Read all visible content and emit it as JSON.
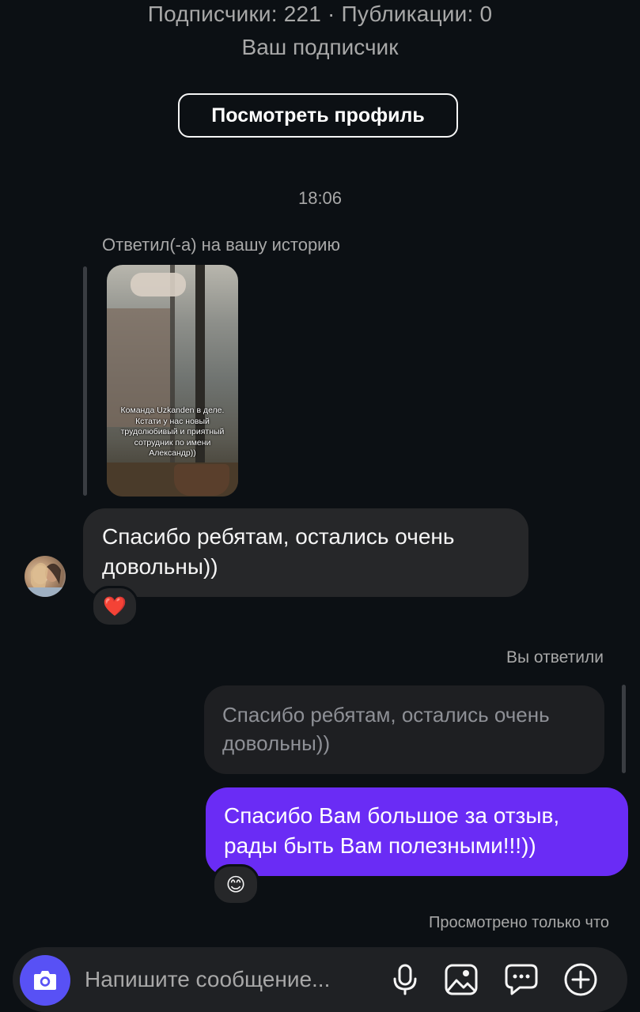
{
  "header": {
    "stats": "Подписчики: 221 · Публикации: 0",
    "subtitle": "Ваш подписчик",
    "view_profile_label": "Посмотреть профиль"
  },
  "thread": {
    "timestamp": "18:06",
    "story_reply_label": "Ответил(-а) на вашу историю",
    "story_caption": "Команда Uzkanden в деле. Кстати у нас новый трудолюбивый и приятный сотрудник по имени Александр))",
    "incoming_message": "Спасибо ребятам, остались очень довольны))",
    "incoming_reaction": "❤️",
    "you_replied_label": "Вы ответили",
    "quoted_message": "Спасибо ребятам, остались очень довольны))",
    "outgoing_message": "Спасибо Вам большое за отзыв, рады быть Вам полезными!!!))",
    "outgoing_reaction": "😊",
    "seen_status": "Просмотрено только что"
  },
  "composer": {
    "placeholder": "Напишите сообщение..."
  },
  "icons": {
    "camera": "camera-icon",
    "microphone": "microphone-icon",
    "gallery": "gallery-icon",
    "chat": "chat-bubble-icon",
    "plus": "plus-circle-icon"
  },
  "colors": {
    "background": "#0c1014",
    "outgoing_bubble": "#6a2cf5",
    "camera_button": "#5851f5"
  }
}
